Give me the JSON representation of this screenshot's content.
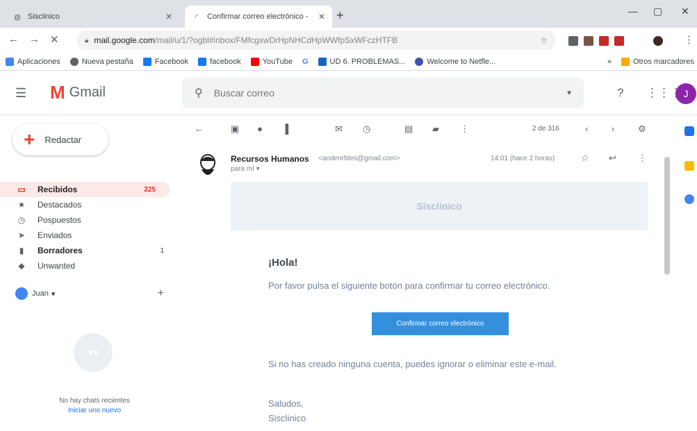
{
  "browser": {
    "tabs": [
      {
        "title": "Sisclinico",
        "active": false
      },
      {
        "title": "Confirmar correo electrónico - ",
        "active": true
      }
    ],
    "url_host": "mail.google.com",
    "url_path": "/mail/u/1/?ogbl#inbox/FMfcgxwDrHpNHCdHpWWfpSxWFczHTFB",
    "bookmarks": [
      "Aplicaciones",
      "Nueva pestaña",
      "Facebook",
      "facebook",
      "YouTube",
      "G",
      "UD 6. PROBLEMAS...",
      "Welcome to Netfle..."
    ],
    "bookmarks_more": "»",
    "other_bookmarks": "Otros marcadores"
  },
  "gmail": {
    "logo_text": "Gmail",
    "search_placeholder": "Buscar correo",
    "avatar_letter": "J",
    "compose_label": "Redactar",
    "nav": [
      {
        "label": "Recibidos",
        "count": "225",
        "icon": "inbox-icon",
        "active": true,
        "bold": true
      },
      {
        "label": "Destacados",
        "count": "",
        "icon": "star-icon",
        "active": false,
        "bold": false
      },
      {
        "label": "Pospuestos",
        "count": "",
        "icon": "clock-icon",
        "active": false,
        "bold": false
      },
      {
        "label": "Enviados",
        "count": "",
        "icon": "send-icon",
        "active": false,
        "bold": false
      },
      {
        "label": "Borradores",
        "count": "1",
        "icon": "draft-icon",
        "active": false,
        "bold": true
      },
      {
        "label": "Unwanted",
        "count": "",
        "icon": "label-icon",
        "active": false,
        "bold": false
      }
    ],
    "hangouts_user": "Juan",
    "chat_empty": "No hay chats recientes",
    "chat_start": "Iniciar uno nuevo",
    "pager": "2 de 316"
  },
  "message": {
    "sender_name": "Recursos Humanos",
    "sender_email": "<andenrfdes@gmail.com>",
    "to": "para mí",
    "time": "14:01 (hace 2 horas)",
    "banner": "Sisclinico",
    "greeting": "¡Hola!",
    "line1": "Por favor pulsa el siguiente botón para confirmar tu correo electrónico.",
    "button": "Confirmar correo electrónico",
    "line2": "Si no has creado ninguna cuenta, puedes ignorar o eliminar este e-mail.",
    "signoff": "Saludos,",
    "signature": "Sisclinico"
  },
  "colors": {
    "gmail_red": "#ea4335",
    "confirm_button": "#3490dc",
    "avatar": "#8e24aa",
    "active_nav_bg": "#fce8e6"
  }
}
